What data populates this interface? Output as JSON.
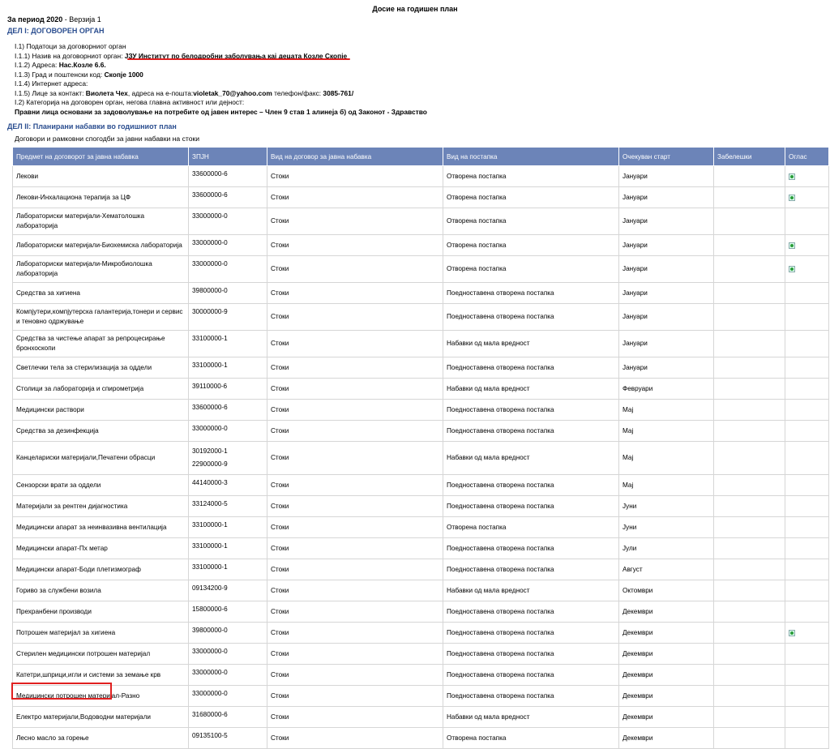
{
  "header": {
    "title": "Досие на годишен план"
  },
  "period": {
    "label": "За период 2020",
    "version": " - Верзија 1"
  },
  "part1": {
    "heading": "ДЕЛ I: ДОГОВОРЕН ОРГАН",
    "lines": {
      "l1_label": "I.1) Податоци за договорниот орган",
      "l11_label": "I.1.1) Назив на договорниот орган: ",
      "l11_value": "ЈЗУ Институт по белодробни заболувања кај децата Козле Скопје",
      "l12_label": "I.1.2) Адреса: ",
      "l12_value": "Нас.Козле 6.6.",
      "l13_label": "I.1.3) Град и поштенски код: ",
      "l13_value": "Скопје 1000",
      "l14_label": "I.1.4) Интернет адреса:",
      "l15_label": "I.1.5) Лице за контакт: ",
      "l15_name": "Виолета Чех",
      "l15_mid": ", адреса на е-пошта:",
      "l15_email": "violetak_70@yahoo.com",
      "l15_phone_label": " телефон/факс: ",
      "l15_phone": "3085-761/",
      "l2_label": "I.2) Категорија на договорен орган, негова главна активност или дејност:",
      "l2_value": "Правни лица основани за задоволување на потребите од јавен интерес – Член 9 став 1 алинеја б) од Законот - Здравство"
    }
  },
  "part2": {
    "heading": "ДЕЛ II: Планирани набавки во годишниот план",
    "subheading": "Договори и рамковни спогодби за јавни набавки на стоки"
  },
  "table": {
    "headers": {
      "subject": "Предмет на договорот за јавна набавка",
      "cpv": "ЗПЈН",
      "contract_type": "Вид на договор за јавна набавка",
      "procedure": "Вид на постапка",
      "start": "Очекуван старт",
      "notes": "Забелешки",
      "ad": "Оглас"
    },
    "rows": [
      {
        "subject": "Лекови",
        "cpv": "33600000-6",
        "type": "Стоки",
        "procedure": "Отворена постапка",
        "start": "Јануари",
        "ad": true
      },
      {
        "subject": "Лекови-Инхалациона терапија за ЦФ",
        "cpv": "33600000-6",
        "type": "Стоки",
        "procedure": "Отворена постапка",
        "start": "Јануари",
        "ad": true
      },
      {
        "subject": "Лабораториски материјали-Хематолошка лабораторија",
        "cpv": "33000000-0",
        "type": "Стоки",
        "procedure": "Отворена постапка",
        "start": "Јануари",
        "ad": false
      },
      {
        "subject": "Лабораториски материјали-Биохемиска лабораторија",
        "cpv": "33000000-0",
        "type": "Стоки",
        "procedure": "Отворена постапка",
        "start": "Јануари",
        "ad": true
      },
      {
        "subject": "Лабораториски материјали-Микробиолошка лабораторија",
        "cpv": "33000000-0",
        "type": "Стоки",
        "procedure": "Отворена постапка",
        "start": "Јануари",
        "ad": true
      },
      {
        "subject": "Средства за хигиена",
        "cpv": "39800000-0",
        "type": "Стоки",
        "procedure": "Поедноставена отворена постапка",
        "start": "Јануари",
        "ad": false
      },
      {
        "subject": "Компјутери,компјутерска галантерија,тонери и сервис и теновно одржување",
        "cpv": "30000000-9",
        "type": "Стоки",
        "procedure": "Поедноставена отворена постапка",
        "start": "Јануари",
        "ad": false
      },
      {
        "subject": "Средства за чистење апарат за репроцесирање бронхоскопи",
        "cpv": "33100000-1",
        "type": "Стоки",
        "procedure": "Набавки од мала вредност",
        "start": "Јануари",
        "ad": false
      },
      {
        "subject": "Светлечки тела за стерилизација за оддели",
        "cpv": "33100000-1",
        "type": "Стоки",
        "procedure": "Поедноставена отворена постапка",
        "start": "Јануари",
        "ad": false
      },
      {
        "subject": "Столици за лабораторија и спирометрија",
        "cpv": "39110000-6",
        "type": "Стоки",
        "procedure": "Набавки од мала вредност",
        "start": "Февруари",
        "ad": false
      },
      {
        "subject": "Медицински раствори",
        "cpv": "33600000-6",
        "type": "Стоки",
        "procedure": "Поедноставена отворена постапка",
        "start": "Мај",
        "ad": false
      },
      {
        "subject": "Средства за дезинфекција",
        "cpv": "33000000-0",
        "type": "Стоки",
        "procedure": "Поедноставена отворена постапка",
        "start": "Мај",
        "ad": false
      },
      {
        "subject": "Канцелариски материјали,Печатени обрасци",
        "cpv": "30192000-1",
        "cpv2": "22900000-9",
        "type": "Стоки",
        "procedure": "Набавки од мала вредност",
        "start": "Мај",
        "ad": false
      },
      {
        "subject": "Сензорски врати за оддели",
        "cpv": "44140000-3",
        "type": "Стоки",
        "procedure": "Поедноставена отворена постапка",
        "start": "Мај",
        "ad": false
      },
      {
        "subject": "Материјали за рентген дијагностика",
        "cpv": "33124000-5",
        "type": "Стоки",
        "procedure": "Поедноставена отворена постапка",
        "start": "Јуни",
        "ad": false
      },
      {
        "subject": "Медицински апарат за неинвазивна вентилација",
        "cpv": "33100000-1",
        "type": "Стоки",
        "procedure": "Отворена постапка",
        "start": "Јуни",
        "ad": false
      },
      {
        "subject": "Медицински апарат-Пх метар",
        "cpv": "33100000-1",
        "type": "Стоки",
        "procedure": "Поедноставена отворена постапка",
        "start": "Јули",
        "ad": false
      },
      {
        "subject": "Медицински апарат-Боди плетизмограф",
        "cpv": "33100000-1",
        "type": "Стоки",
        "procedure": "Поедноставена отворена постапка",
        "start": "Август",
        "ad": false
      },
      {
        "subject": "Гориво за службени возила",
        "cpv": "09134200-9",
        "type": "Стоки",
        "procedure": "Набавки од мала вредност",
        "start": "Октомври",
        "ad": false
      },
      {
        "subject": "Прехранбени производи",
        "cpv": "15800000-6",
        "type": "Стоки",
        "procedure": "Поедноставена отворена постапка",
        "start": "Декември",
        "ad": false
      },
      {
        "subject": "Потрошен материјал за хигиена",
        "cpv": "39800000-0",
        "type": "Стоки",
        "procedure": "Поедноставена отворена постапка",
        "start": "Декември",
        "ad": true
      },
      {
        "subject": "Стерилен медицински потрошен материјал",
        "cpv": "33000000-0",
        "type": "Стоки",
        "procedure": "Поедноставена отворена постапка",
        "start": "Декември",
        "ad": false
      },
      {
        "subject": "Катетри,шприци,игли и системи за земање крв",
        "cpv": "33000000-0",
        "type": "Стоки",
        "procedure": "Поедноставена отворена постапка",
        "start": "Декември",
        "ad": false
      },
      {
        "subject": "Медицински потрошен материјал-Разно",
        "cpv": "33000000-0",
        "type": "Стоки",
        "procedure": "Поедноставена отворена постапка",
        "start": "Декември",
        "ad": false
      },
      {
        "subject": "Електро материјали,Водоводни материјали",
        "cpv": "31680000-6",
        "type": "Стоки",
        "procedure": "Набавки од мала вредност",
        "start": "Декември",
        "ad": false
      },
      {
        "subject": "Лесно масло за горење",
        "cpv": "09135100-5",
        "type": "Стоки",
        "procedure": "Отворена постапка",
        "start": "Декември",
        "ad": false
      }
    ]
  },
  "annotations": {
    "highlight_color": "#e02020"
  }
}
